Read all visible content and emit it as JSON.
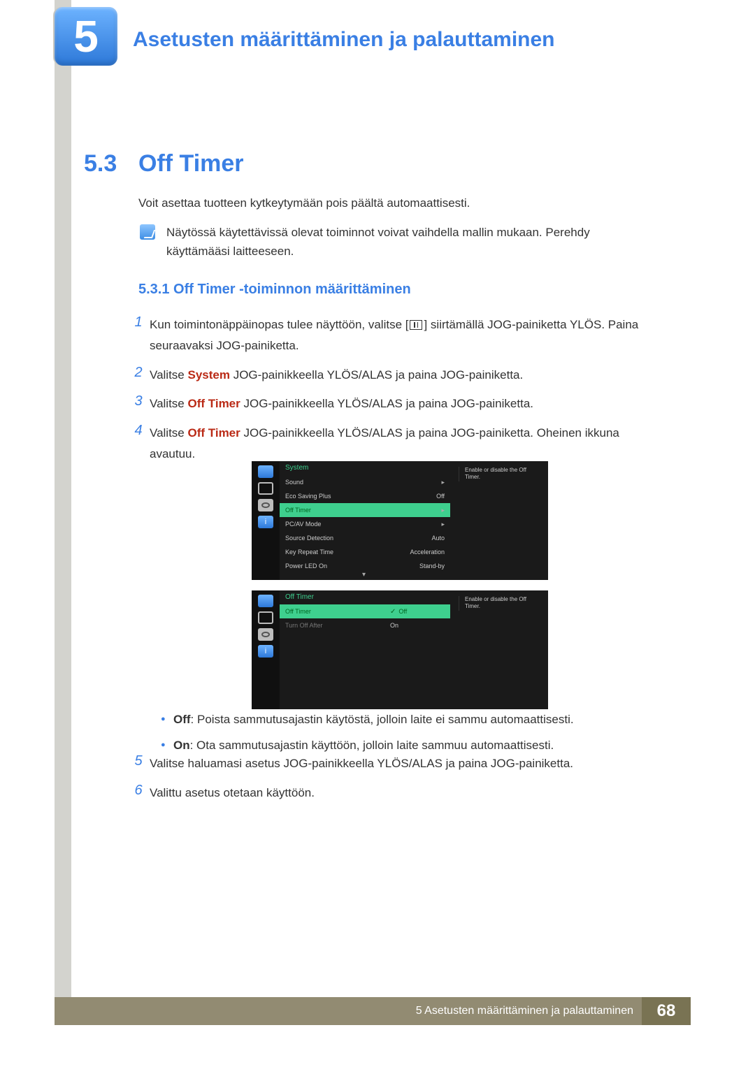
{
  "chapter": {
    "number": "5",
    "title": "Asetusten määrittäminen ja palauttaminen"
  },
  "section": {
    "number": "5.3",
    "title": "Off Timer"
  },
  "intro": "Voit asettaa tuotteen kytkeytymään pois päältä automaattisesti.",
  "note": "Näytössä käytettävissä olevat toiminnot voivat vaihdella mallin mukaan. Perehdy käyttämääsi laitteeseen.",
  "subsection": "5.3.1  Off Timer -toiminnon määrittäminen",
  "steps": [
    {
      "n": "1",
      "pre": "Kun toimintonäppäinopas tulee näyttöön, valitse [",
      "post": "] siirtämällä JOG-painiketta YLÖS. Paina seuraavaksi JOG-painiketta."
    },
    {
      "n": "2",
      "pre": "Valitse ",
      "hi": "System",
      "post": " JOG-painikkeella YLÖS/ALAS ja paina JOG-painiketta."
    },
    {
      "n": "3",
      "pre": "Valitse ",
      "hi": "Off Timer",
      "post": " JOG-painikkeella YLÖS/ALAS ja paina JOG-painiketta."
    },
    {
      "n": "4",
      "pre": "Valitse ",
      "hi": "Off Timer",
      "post": " JOG-painikkeella YLÖS/ALAS ja paina JOG-painiketta. Oheinen ikkuna avautuu."
    }
  ],
  "osd1": {
    "header": "System",
    "desc": "Enable or disable the Off Timer.",
    "rows": [
      {
        "label": "Sound",
        "value": "",
        "arrow": true,
        "sel": false
      },
      {
        "label": "Eco Saving Plus",
        "value": "Off",
        "arrow": false,
        "sel": false
      },
      {
        "label": "Off Timer",
        "value": "",
        "arrow": true,
        "sel": true
      },
      {
        "label": "PC/AV Mode",
        "value": "",
        "arrow": true,
        "sel": false
      },
      {
        "label": "Source Detection",
        "value": "Auto",
        "arrow": false,
        "sel": false
      },
      {
        "label": "Key Repeat Time",
        "value": "Acceleration",
        "arrow": false,
        "sel": false
      },
      {
        "label": "Power LED On",
        "value": "Stand-by",
        "arrow": false,
        "sel": false
      }
    ]
  },
  "osd2": {
    "header": "Off Timer",
    "desc": "Enable or disable the Off Timer.",
    "rows": [
      {
        "label": "Off Timer",
        "sel": true
      },
      {
        "label": "Turn Off After",
        "sel": false,
        "grey": true
      }
    ],
    "popup": [
      {
        "label": "Off",
        "sel": true
      },
      {
        "label": "On",
        "sel": false
      }
    ]
  },
  "bullets": [
    {
      "b": "Off",
      "t": ": Poista sammutusajastin käytöstä, jolloin laite ei sammu automaattisesti."
    },
    {
      "b": "On",
      "t": ": Ota sammutusajastin käyttöön, jolloin laite sammuu automaattisesti."
    }
  ],
  "steps2": [
    {
      "n": "5",
      "t": "Valitse haluamasi asetus JOG-painikkeella YLÖS/ALAS ja paina JOG-painiketta."
    },
    {
      "n": "6",
      "t": "Valittu asetus otetaan käyttöön."
    }
  ],
  "footer": {
    "text": "5  Asetusten määrittäminen ja palauttaminen",
    "page": "68"
  }
}
